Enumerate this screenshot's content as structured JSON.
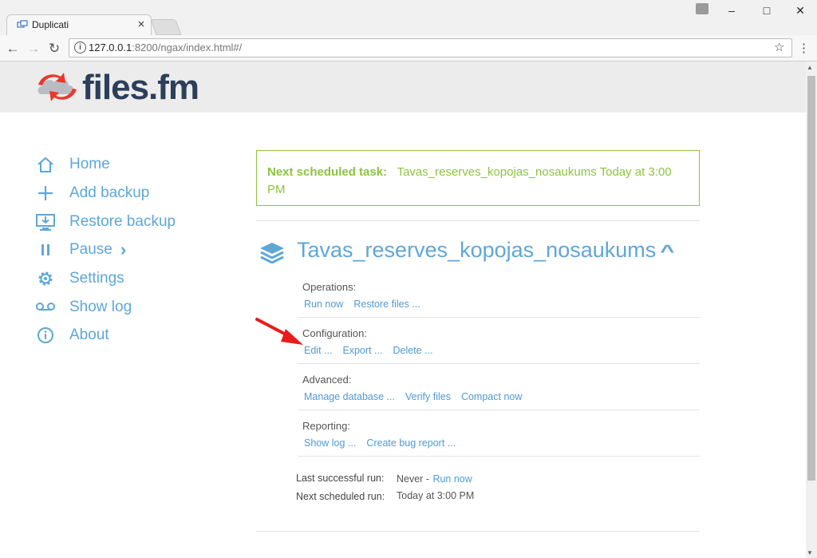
{
  "browser": {
    "tab_title": "Duplicati",
    "tab_close": "×",
    "url_host": "127.0.0.1",
    "url_rest": ":8200/ngax/index.html#/",
    "minimize": "–",
    "maximize": "□",
    "close": "✕",
    "back": "←",
    "forward": "→",
    "reload": "↻",
    "info": "i",
    "star": "☆",
    "menu": "⋮"
  },
  "brand": {
    "logo_text": "files.fm",
    "accent": "#e8382c",
    "text_color": "#2c3e5a"
  },
  "sidebar": {
    "items": [
      {
        "label": "Home",
        "icon": "home-icon"
      },
      {
        "label": "Add backup",
        "icon": "plus-icon"
      },
      {
        "label": "Restore backup",
        "icon": "restore-icon"
      },
      {
        "label": "Pause",
        "icon": "pause-icon",
        "chevron": "›"
      },
      {
        "label": "Settings",
        "icon": "gear-icon"
      },
      {
        "label": "Show log",
        "icon": "log-icon"
      },
      {
        "label": "About",
        "icon": "info-icon"
      }
    ]
  },
  "scheduled": {
    "label": "Next scheduled task:",
    "value": "Tavas_reserves_kopojas_nosaukums Today at 3:00 PM",
    "color": "#8cc43f"
  },
  "backup": {
    "name": "Tavas_reserves_kopojas_nosaukums",
    "chevron": "^",
    "sections": [
      {
        "label": "Operations:",
        "links": [
          "Run now",
          "Restore files ..."
        ]
      },
      {
        "label": "Configuration:",
        "links": [
          "Edit ...",
          "Export ...",
          "Delete ..."
        ]
      },
      {
        "label": "Advanced:",
        "links": [
          "Manage database ...",
          "Verify files",
          "Compact now"
        ]
      },
      {
        "label": "Reporting:",
        "links": [
          "Show log ...",
          "Create bug report ..."
        ]
      }
    ],
    "last_run_label": "Last successful run:",
    "last_run_value": "Never -",
    "last_run_link": "Run now",
    "next_run_label": "Next scheduled run:",
    "next_run_value": "Today at 3:00 PM"
  }
}
